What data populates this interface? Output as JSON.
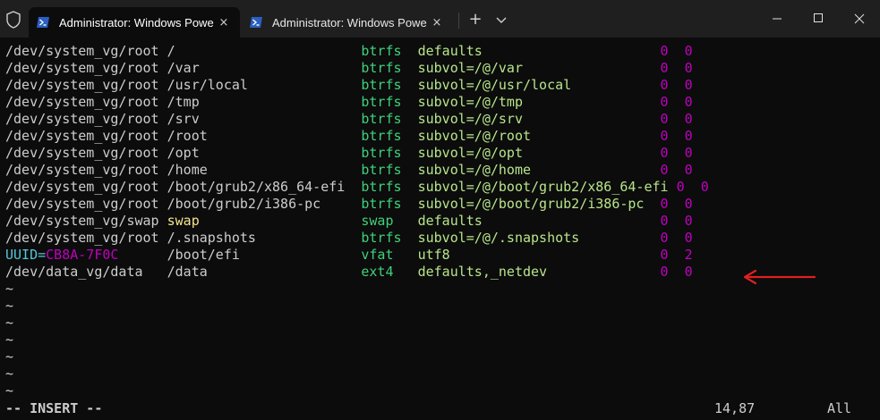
{
  "window": {
    "tabs": [
      {
        "label": "Administrator: Windows Powe",
        "icon": "powershell-icon",
        "active": true
      },
      {
        "label": "Administrator: Windows Powe",
        "icon": "powershell-icon",
        "active": false
      }
    ],
    "new_tab_symbol": "+",
    "tab_close_symbol": "×",
    "controls": [
      "minimize-icon",
      "maximize-icon",
      "close-icon"
    ]
  },
  "fstab": [
    {
      "device": "/dev/system_vg/root",
      "mount": "/",
      "type": "btrfs",
      "options": "defaults",
      "dump": "0",
      "pass": "0"
    },
    {
      "device": "/dev/system_vg/root",
      "mount": "/var",
      "type": "btrfs",
      "options": "subvol=/@/var",
      "dump": "0",
      "pass": "0"
    },
    {
      "device": "/dev/system_vg/root",
      "mount": "/usr/local",
      "type": "btrfs",
      "options": "subvol=/@/usr/local",
      "dump": "0",
      "pass": "0"
    },
    {
      "device": "/dev/system_vg/root",
      "mount": "/tmp",
      "type": "btrfs",
      "options": "subvol=/@/tmp",
      "dump": "0",
      "pass": "0"
    },
    {
      "device": "/dev/system_vg/root",
      "mount": "/srv",
      "type": "btrfs",
      "options": "subvol=/@/srv",
      "dump": "0",
      "pass": "0"
    },
    {
      "device": "/dev/system_vg/root",
      "mount": "/root",
      "type": "btrfs",
      "options": "subvol=/@/root",
      "dump": "0",
      "pass": "0"
    },
    {
      "device": "/dev/system_vg/root",
      "mount": "/opt",
      "type": "btrfs",
      "options": "subvol=/@/opt",
      "dump": "0",
      "pass": "0"
    },
    {
      "device": "/dev/system_vg/root",
      "mount": "/home",
      "type": "btrfs",
      "options": "subvol=/@/home",
      "dump": "0",
      "pass": "0"
    },
    {
      "device": "/dev/system_vg/root",
      "mount": "/boot/grub2/x86_64-efi",
      "type": "btrfs",
      "options": "subvol=/@/boot/grub2/x86_64-efi",
      "dump": "0",
      "pass": "0"
    },
    {
      "device": "/dev/system_vg/root",
      "mount": "/boot/grub2/i386-pc",
      "type": "btrfs",
      "options": "subvol=/@/boot/grub2/i386-pc",
      "dump": "0",
      "pass": "0"
    },
    {
      "device": "/dev/system_vg/swap",
      "mount": "swap",
      "type": "swap",
      "options": "defaults",
      "dump": "0",
      "pass": "0"
    },
    {
      "device": "/dev/system_vg/root",
      "mount": "/.snapshots",
      "type": "btrfs",
      "options": "subvol=/@/.snapshots",
      "dump": "0",
      "pass": "0"
    },
    {
      "device_key": "UUID=",
      "device_value": "CB8A-7F0C",
      "mount": "/boot/efi",
      "type": "vfat",
      "options": "utf8",
      "dump": "0",
      "pass": "2"
    },
    {
      "device": "/dev/data_vg/data",
      "mount": "/data",
      "type": "ext4",
      "options": "defaults,_netdev",
      "dump": "0",
      "pass": "0"
    }
  ],
  "tilde_count": 7,
  "tilde_char": "~",
  "status": {
    "mode": "-- INSERT --",
    "position": "14,87",
    "scroll": "All"
  },
  "colors": {
    "background": "#0c0c0c",
    "fstype": "#3fd17a",
    "options": "#b7e58a",
    "numbers": "#c000c0",
    "swap_mount": "#f5e48c",
    "uuid_key": "#55c6d8",
    "tilde": "#3b78ff",
    "annotation_arrow": "#e02020"
  },
  "annotation": {
    "icon": "red-arrow-icon",
    "points_to_line": 14
  }
}
